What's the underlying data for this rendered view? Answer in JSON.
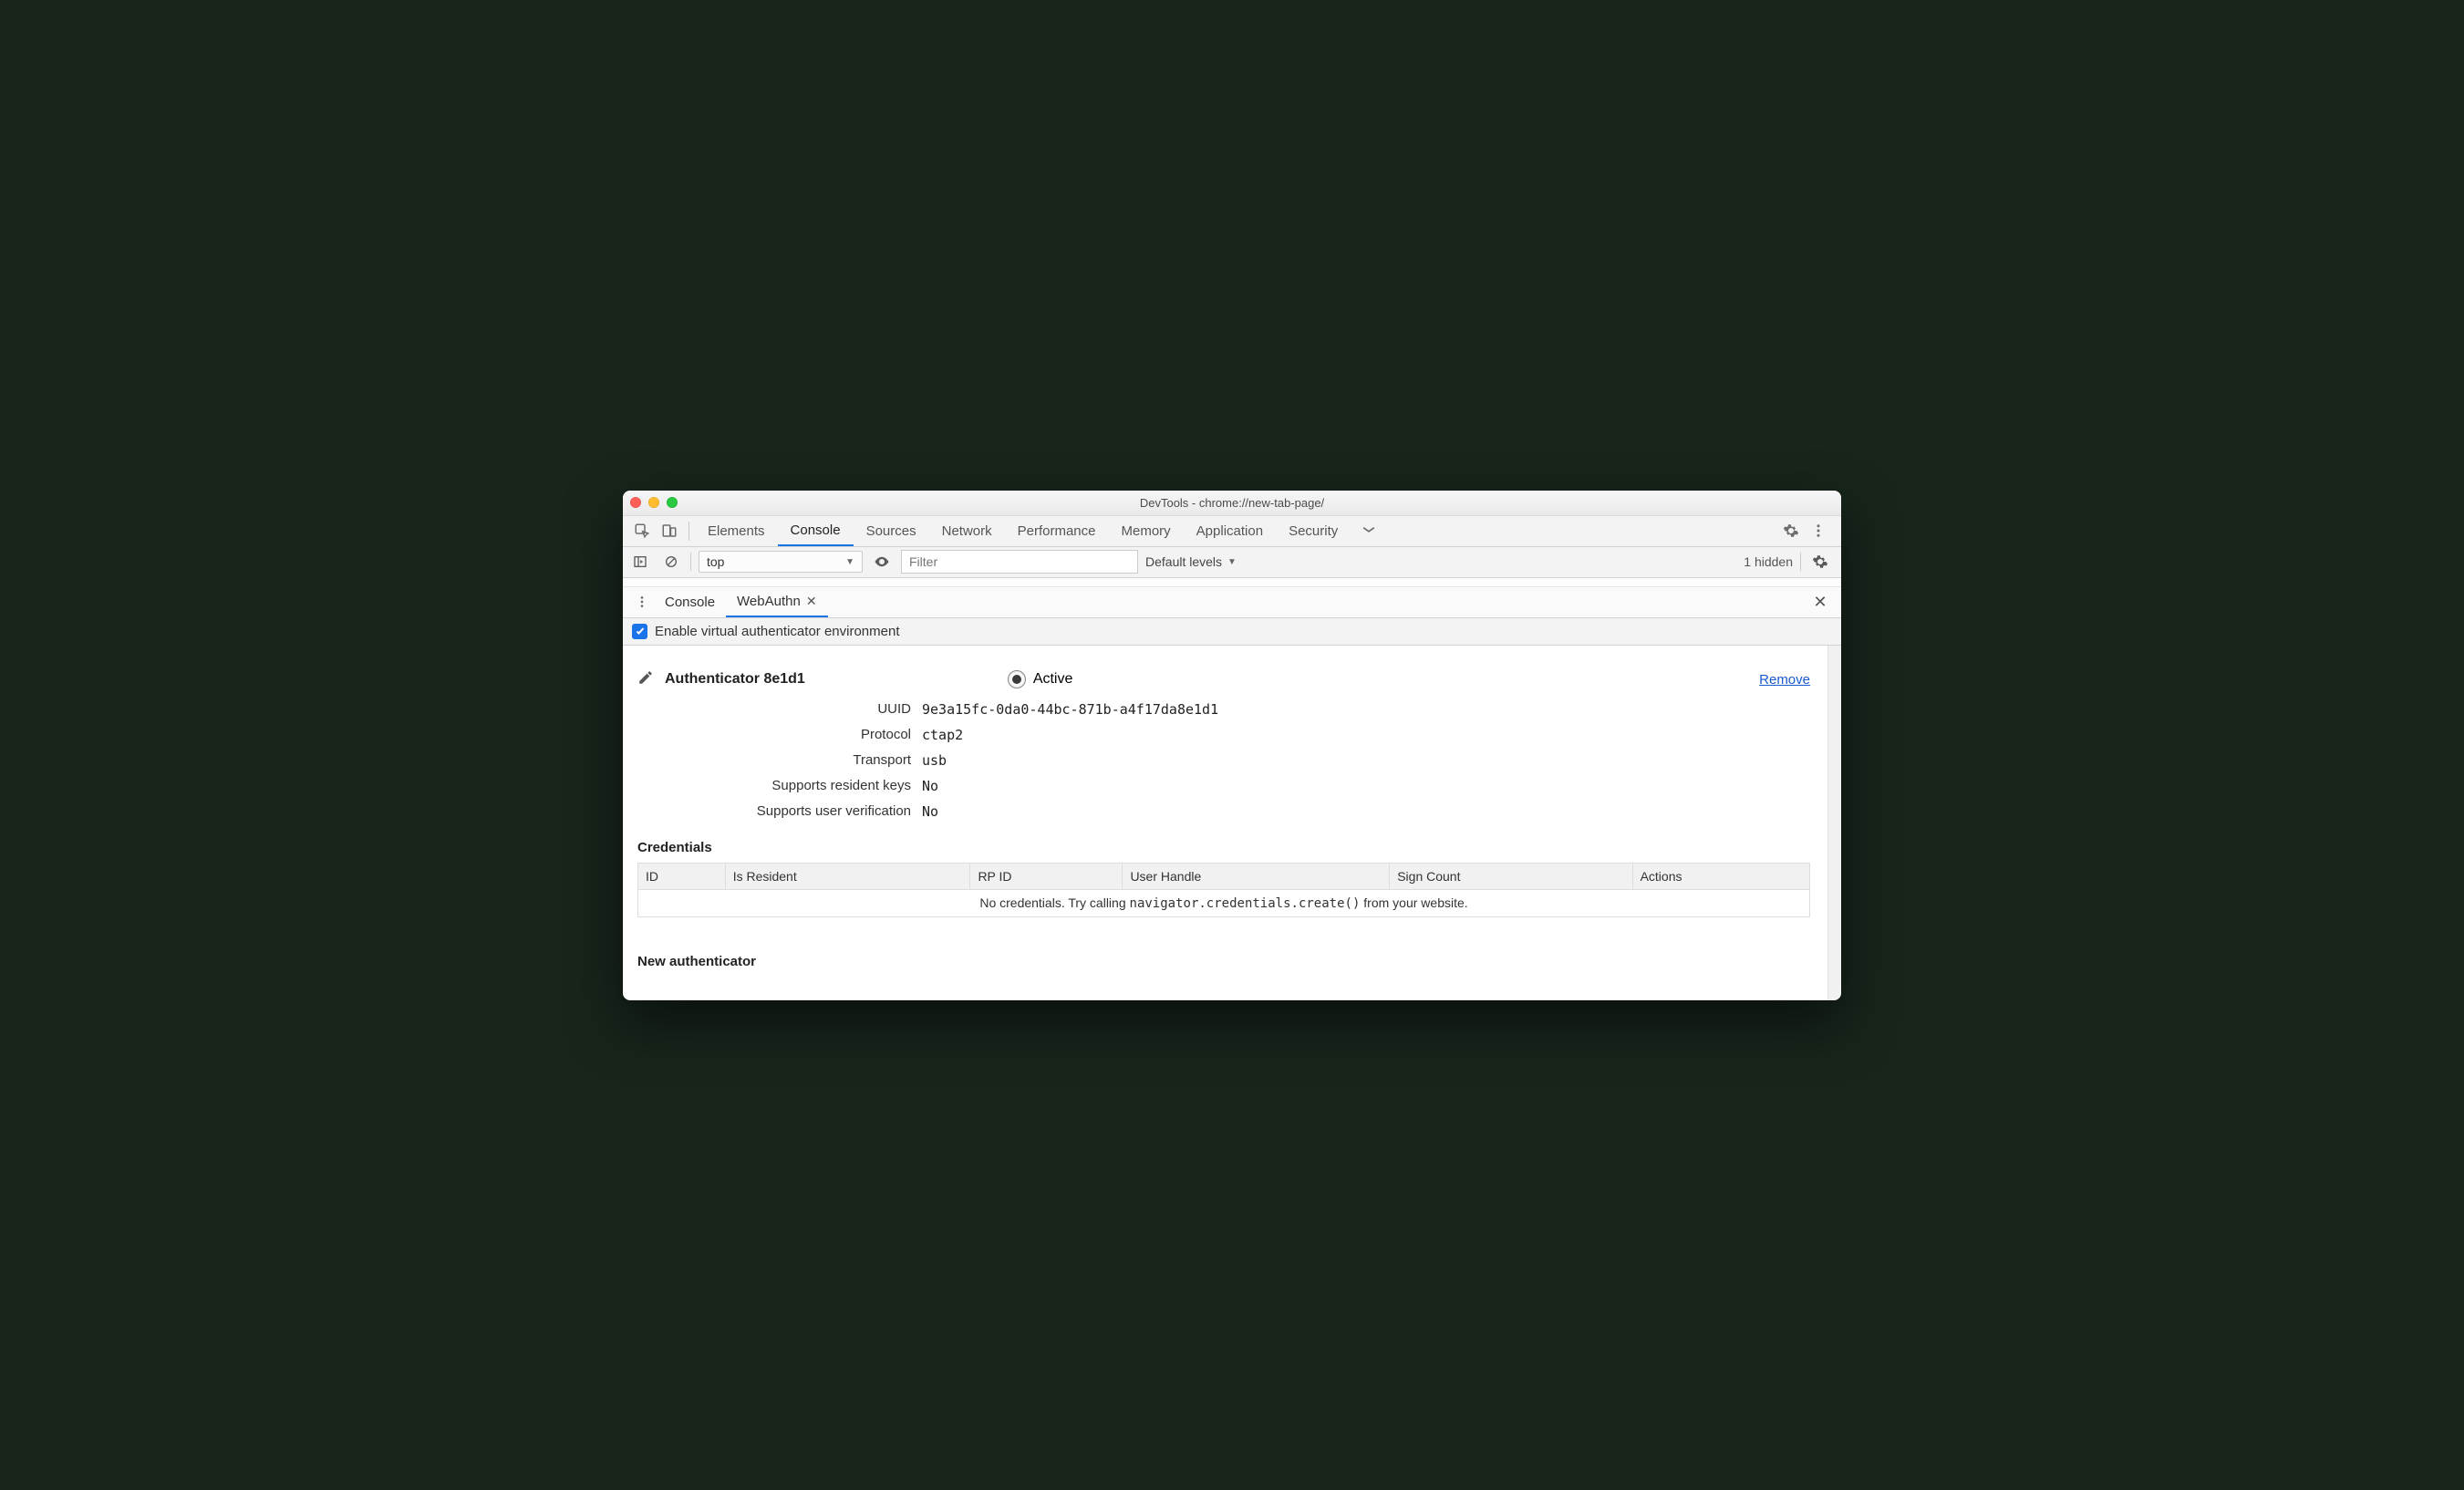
{
  "window": {
    "title": "DevTools - chrome://new-tab-page/"
  },
  "main_tabs": {
    "items": [
      "Elements",
      "Console",
      "Sources",
      "Network",
      "Performance",
      "Memory",
      "Application",
      "Security"
    ],
    "active": "Console"
  },
  "console_toolbar": {
    "context": "top",
    "filter_placeholder": "Filter",
    "levels": "Default levels",
    "hidden": "1 hidden"
  },
  "drawer": {
    "tabs": [
      "Console",
      "WebAuthn"
    ],
    "active": "WebAuthn"
  },
  "enable": {
    "label": "Enable virtual authenticator environment",
    "checked": true
  },
  "authenticator": {
    "title": "Authenticator 8e1d1",
    "active_label": "Active",
    "remove": "Remove",
    "fields": {
      "uuid_label": "UUID",
      "uuid": "9e3a15fc-0da0-44bc-871b-a4f17da8e1d1",
      "protocol_label": "Protocol",
      "protocol": "ctap2",
      "transport_label": "Transport",
      "transport": "usb",
      "resident_label": "Supports resident keys",
      "resident": "No",
      "userverify_label": "Supports user verification",
      "userverify": "No"
    }
  },
  "credentials": {
    "heading": "Credentials",
    "columns": [
      "ID",
      "Is Resident",
      "RP ID",
      "User Handle",
      "Sign Count",
      "Actions"
    ],
    "empty_pre": "No credentials. Try calling ",
    "empty_code": "navigator.credentials.create()",
    "empty_post": " from your website."
  },
  "new_auth": {
    "heading": "New authenticator"
  }
}
